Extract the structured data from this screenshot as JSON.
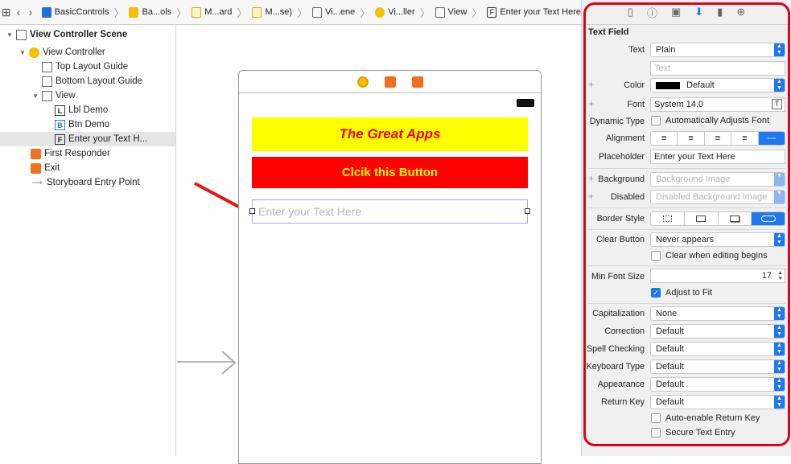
{
  "breadcrumb": [
    "BasicControls",
    "Ba...ols",
    "M...ard",
    "M...se)",
    "Vi...ene",
    "Vi...ller",
    "View",
    "Enter your Text Here"
  ],
  "outline": {
    "scene": "View Controller Scene",
    "controller": "View Controller",
    "top_guide": "Top Layout Guide",
    "bottom_guide": "Bottom Layout Guide",
    "view": "View",
    "lbl": "Lbl Demo",
    "btn": "Btn Demo",
    "tf": "Enter your Text H...",
    "responder": "First Responder",
    "exit": "Exit",
    "entry": "Storyboard Entry Point",
    "glyph_l": "L",
    "glyph_b": "B",
    "glyph_f": "F"
  },
  "canvas": {
    "label_text": "The Great Apps",
    "button_text": "Clcik this Button",
    "textfield_placeholder": "Enter your Text Here"
  },
  "inspector": {
    "section": "Text Field",
    "text_label": "Text",
    "text_value": "Plain",
    "text_placeholder": "Text",
    "color_label": "Color",
    "color_value": "Default",
    "font_label": "Font",
    "font_value": "System 14.0",
    "dynamic_label": "Dynamic Type",
    "dynamic_value": "Automatically Adjusts Font",
    "alignment_label": "Alignment",
    "placeholder_label": "Placeholder",
    "placeholder_value": "Enter your Text Here",
    "background_label": "Background",
    "background_value": "Background Image",
    "disabled_label": "Disabled",
    "disabled_value": "Disabled Background Image",
    "border_label": "Border Style",
    "clear_label": "Clear Button",
    "clear_value": "Never appears",
    "clear_edit": "Clear when editing begins",
    "minfont_label": "Min Font Size",
    "minfont_value": "17",
    "adjust": "Adjust to Fit",
    "cap_label": "Capitalization",
    "cap_value": "None",
    "corr_label": "Correction",
    "corr_value": "Default",
    "spell_label": "Spell Checking",
    "spell_value": "Default",
    "kb_label": "Keyboard Type",
    "kb_value": "Default",
    "app_label": "Appearance",
    "app_value": "Default",
    "ret_label": "Return Key",
    "ret_value": "Default",
    "auto_enable": "Auto-enable Return Key",
    "secure": "Secure Text Entry"
  },
  "colors": {
    "accent": "#1e78f0",
    "highlight": "#e0001a",
    "label_bg": "#ffff00",
    "button_bg": "#ff0000"
  }
}
